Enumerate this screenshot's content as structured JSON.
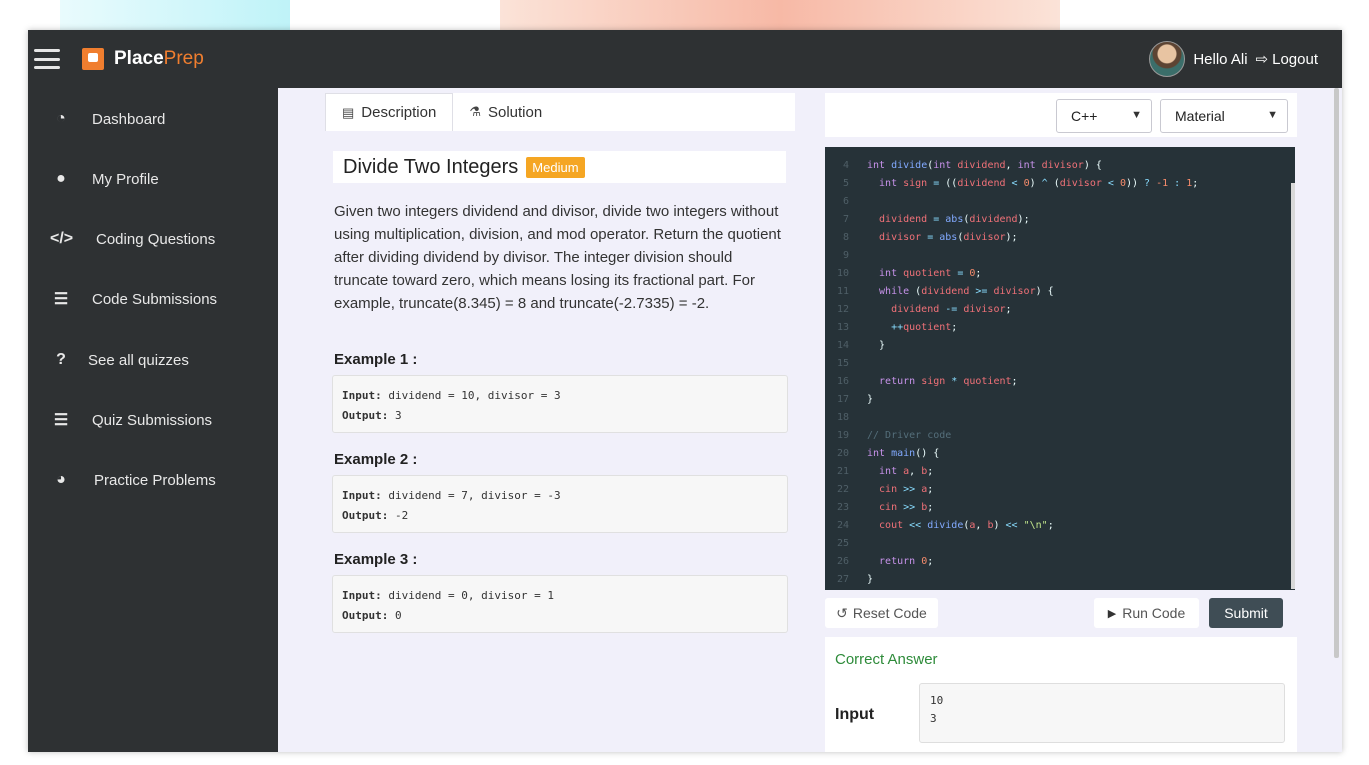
{
  "header": {
    "brand_primary": "Place",
    "brand_secondary": "Prep",
    "greeting": "Hello Ali",
    "logout_label": "Logout"
  },
  "sidebar": {
    "items": [
      {
        "label": "Dashboard",
        "icon": "dashboard-icon"
      },
      {
        "label": "My Profile",
        "icon": "user-circle-icon"
      },
      {
        "label": "Coding Questions",
        "icon": "code-icon"
      },
      {
        "label": "Code Submissions",
        "icon": "list-check-icon"
      },
      {
        "label": "See all quizzes",
        "icon": "question-mark-icon"
      },
      {
        "label": "Quiz Submissions",
        "icon": "list-check-icon"
      },
      {
        "label": "Practice Problems",
        "icon": "pie-chart-icon"
      }
    ]
  },
  "tabs": {
    "description": "Description",
    "solution": "Solution"
  },
  "problem": {
    "title": "Divide Two Integers",
    "difficulty": "Medium",
    "description": "Given two integers dividend and divisor, divide two integers without using multiplication, division, and mod operator. Return the quotient after dividing dividend by divisor. The integer division should truncate toward zero, which means losing its fractional part. For example, truncate(8.345) = 8 and truncate(-2.7335) = -2.",
    "examples": [
      {
        "title": "Example 1 :",
        "input": "dividend = 10, divisor = 3",
        "output": "3"
      },
      {
        "title": "Example 2 :",
        "input": "dividend = 7, divisor = -3",
        "output": "-2"
      },
      {
        "title": "Example 3 :",
        "input": "dividend = 0, divisor = 1",
        "output": "0"
      }
    ],
    "input_label": "Input:",
    "output_label": "Output:"
  },
  "editor": {
    "language": "C++",
    "theme": "Material",
    "reset_label": "Reset Code",
    "run_label": "Run Code",
    "submit_label": "Submit"
  },
  "result": {
    "status": "Correct Answer",
    "input_label": "Input",
    "input_lines": [
      "10",
      "3"
    ]
  },
  "colors": {
    "sidebar_bg": "#2e3133",
    "accent_orange": "#f07e2f",
    "difficulty_badge": "#f5a623",
    "editor_bg": "#263238",
    "success_green": "#2e8b3a",
    "submit_bg": "#3f4d55"
  }
}
